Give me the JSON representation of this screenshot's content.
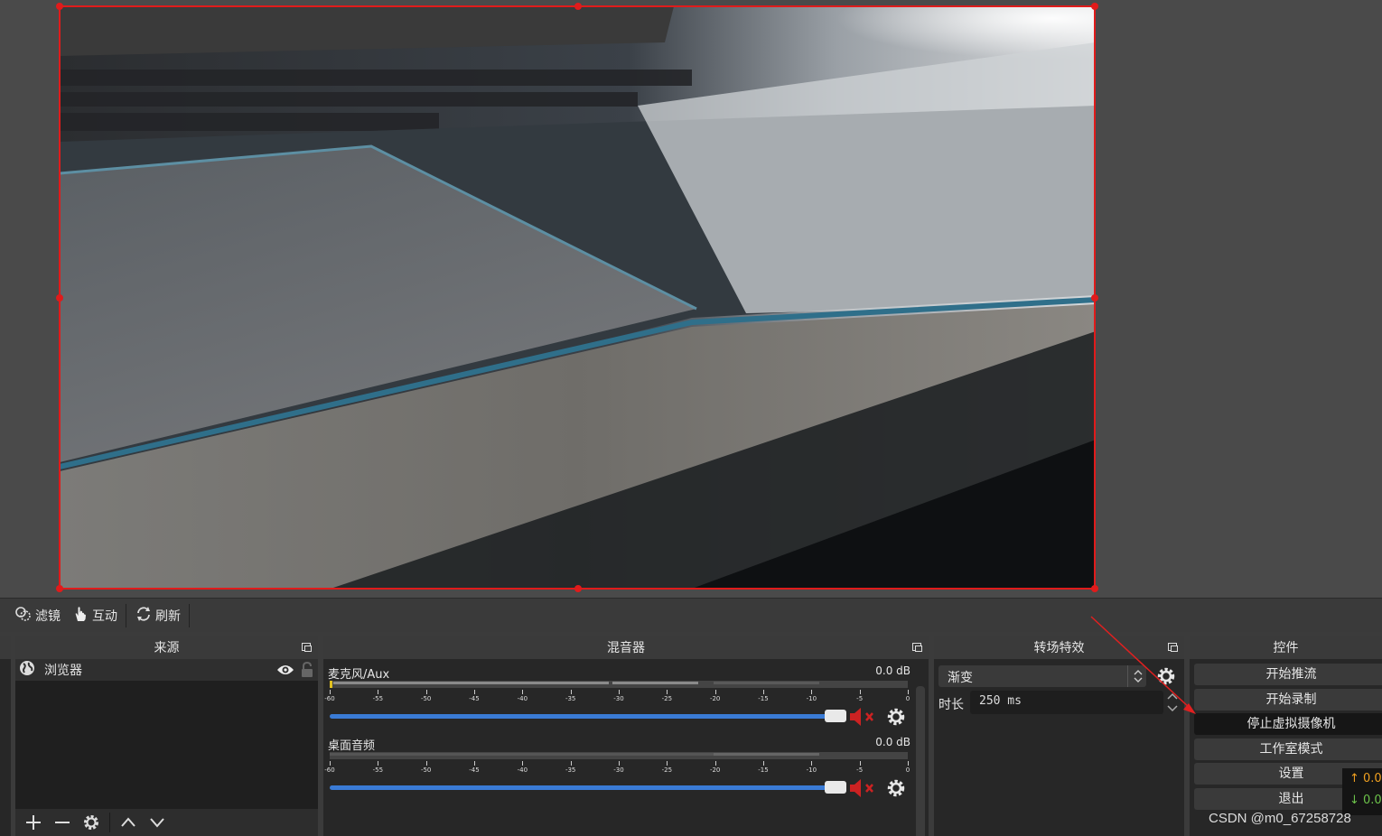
{
  "toolbar": {
    "filters_label": "滤镜",
    "interact_label": "互动",
    "refresh_label": "刷新"
  },
  "sources": {
    "title": "来源",
    "items": [
      {
        "label": "浏览器",
        "visible": true,
        "locked": false
      }
    ]
  },
  "mixer": {
    "title": "混音器",
    "channels": [
      {
        "name": "麦克风/Aux",
        "level": "0.0 dB",
        "muted": true
      },
      {
        "name": "桌面音频",
        "level": "0.0 dB",
        "muted": true
      }
    ],
    "scale_ticks": [
      "-60",
      "-55",
      "-50",
      "-45",
      "-40",
      "-35",
      "-30",
      "-25",
      "-20",
      "-15",
      "-10",
      "-5",
      "0"
    ]
  },
  "transitions": {
    "title": "转场特效",
    "selected": "渐变",
    "duration_label": "时长",
    "duration_value": "250 ms"
  },
  "controls": {
    "title": "控件",
    "buttons": {
      "start_stream": "开始推流",
      "start_record": "开始录制",
      "stop_virtual_cam": "停止虚拟摄像机",
      "studio_mode": "工作室模式",
      "settings": "设置",
      "exit": "退出"
    }
  },
  "stats": {
    "upload": "↑ 0.0",
    "download": "↓ 0.0"
  },
  "watermark": "CSDN @m0_67258728",
  "colors": {
    "selection": "#e01b1b",
    "slider": "#3a7bd5",
    "mute": "#cc2222",
    "upload": "#f0a020",
    "download": "#6cc24a"
  }
}
